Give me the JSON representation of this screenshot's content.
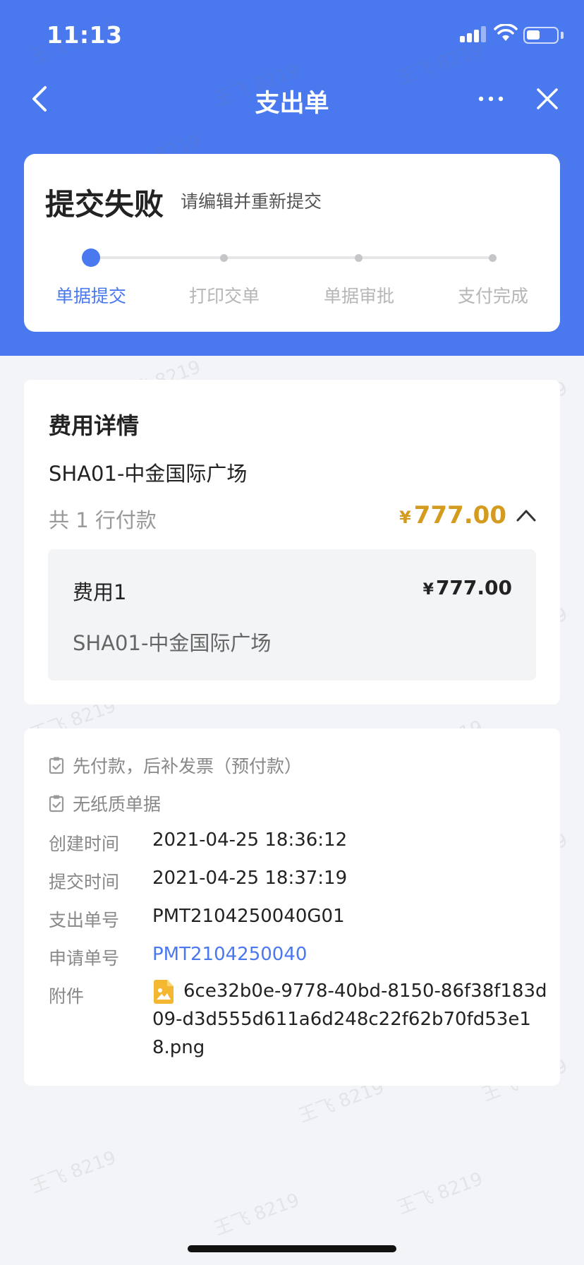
{
  "status_bar": {
    "time": "11:13",
    "battery_level": 0.45
  },
  "nav": {
    "title": "支出单"
  },
  "status": {
    "title": "提交失败",
    "subtitle": "请编辑并重新提交",
    "steps": [
      "单据提交",
      "打印交单",
      "单据审批",
      "支付完成"
    ],
    "active_step": 0
  },
  "expense": {
    "title": "费用详情",
    "location": "SHA01-中金国际广场",
    "count_text": "共 1 行付款",
    "currency": "¥",
    "total": "777.00",
    "items": [
      {
        "name": "费用1",
        "amount": "777.00",
        "location": "SHA01-中金国际广场"
      }
    ]
  },
  "details": {
    "tags": [
      "先付款，后补发票（预付款）",
      "无纸质单据"
    ],
    "fields": [
      {
        "label": "创建时间",
        "value": "2021-04-25 18:36:12"
      },
      {
        "label": "提交时间",
        "value": "2021-04-25 18:37:19"
      },
      {
        "label": "支出单号",
        "value": "PMT2104250040G01"
      },
      {
        "label": "申请单号",
        "value": "PMT2104250040"
      }
    ],
    "attachment_label": "附件",
    "attachment_name": "6ce32b0e-9778-40bd-8150-86f38f183d09-d3d555d611a6d248c22f62b70fd53e18.png"
  },
  "watermark": {
    "name": "王飞",
    "code": "8219"
  },
  "colors": {
    "primary": "#4a78ef",
    "amount": "#d59b1e"
  }
}
